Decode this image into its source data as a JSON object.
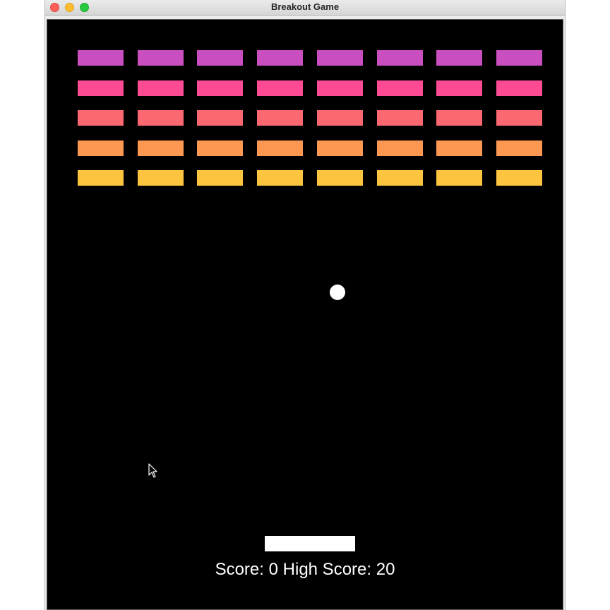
{
  "window": {
    "title": "Breakout Game"
  },
  "game": {
    "bricks": {
      "rows": 5,
      "columns": 8,
      "row_colors": [
        "#c94fc0",
        "#fc4a93",
        "#fc6872",
        "#fd9853",
        "#fdc53f"
      ]
    },
    "score_label": "Score:",
    "score": "0",
    "high_score_label": "High Score:",
    "high_score": "20",
    "ball_color": "#ffffff",
    "paddle_color": "#ffffff",
    "background_color": "#000000"
  }
}
